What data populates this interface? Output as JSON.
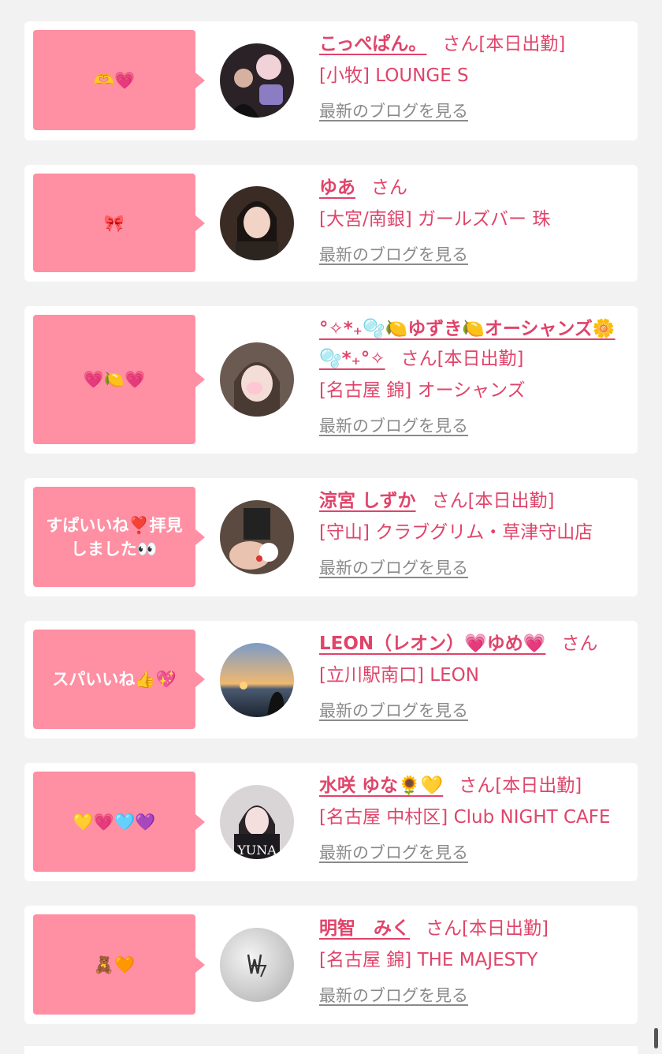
{
  "cards": [
    {
      "message": "🫶💗",
      "name": "こっぺぱん。",
      "honorific": "さん",
      "status": "[本日出勤]",
      "shop": "[小牧] LOUNGE S",
      "blog_link": "最新のブログを見る",
      "avatar_icon": "avatar-photo-icon"
    },
    {
      "message": "🎀",
      "name": "ゆあ",
      "honorific": "さん",
      "status": "",
      "shop": "[大宮/南銀] ガールズバー 珠",
      "blog_link": "最新のブログを見る",
      "avatar_icon": "avatar-photo-icon"
    },
    {
      "message": "💗🍋💗",
      "name": "°✧*₊🫧🍋ゆずき🍋オーシャンズ🌼🫧*₊°✧",
      "honorific": "さん",
      "status": "[本日出勤]",
      "shop": "[名古屋 錦] オーシャンズ",
      "blog_link": "最新のブログを見る",
      "avatar_icon": "avatar-photo-icon"
    },
    {
      "message": "すぱいいね❣️拝見しました👀",
      "name": "涼宮 しずか",
      "honorific": "さん",
      "status": "[本日出勤]",
      "shop": "[守山] クラブグリム・草津守山店",
      "blog_link": "最新のブログを見る",
      "avatar_icon": "avatar-photo-icon"
    },
    {
      "message": "スパいいね👍💖",
      "name": "LEON（レオン）💗ゆめ💗",
      "honorific": "さん",
      "status": "",
      "shop": "[立川駅南口] LEON",
      "blog_link": "最新のブログを見る",
      "avatar_icon": "avatar-photo-icon"
    },
    {
      "message": "💛💗🩵💜",
      "name": "水咲 ゆな🌻💛",
      "honorific": "さん",
      "status": "[本日出勤]",
      "shop": "[名古屋 中村区] Club NIGHT CAFE",
      "blog_link": "最新のブログを見る",
      "avatar_icon": "avatar-photo-icon",
      "avatar_text": "YUNA"
    },
    {
      "message": "🧸🧡",
      "name": "明智　みく",
      "honorific": "さん",
      "status": "[本日出勤]",
      "shop": "[名古屋 錦] THE MAJESTY",
      "blog_link": "最新のブログを見る",
      "avatar_icon": "avatar-logo-icon"
    }
  ],
  "colors": {
    "accent": "#e0446a",
    "bubble": "#ff8fa3",
    "link_gray": "#8a8a8a",
    "background": "#f2f2f2"
  }
}
